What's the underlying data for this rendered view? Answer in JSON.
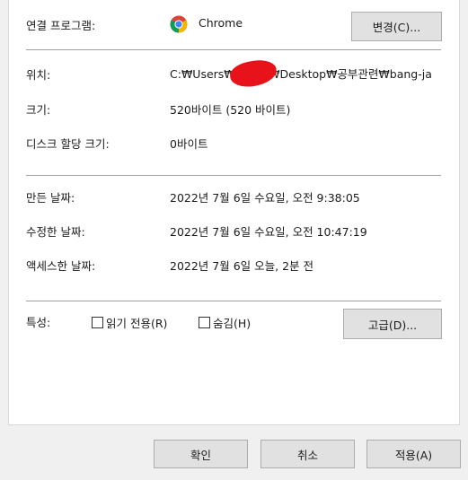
{
  "opens_with": {
    "label": "연결 프로그램:",
    "app_name": "Chrome",
    "icon": "chrome-icon",
    "change_button": "변경(C)..."
  },
  "location": {
    "label": "위치:",
    "value": "C:₩Users₩　　　₩Desktop₩공부관련₩bang-ja"
  },
  "size": {
    "label": "크기:",
    "value": "520바이트 (520 바이트)"
  },
  "size_on_disk": {
    "label": "디스크 할당 크기:",
    "value": "0바이트"
  },
  "created": {
    "label": "만든 날짜:",
    "value": "2022년 7월 6일 수요일, 오전 9:38:05"
  },
  "modified": {
    "label": "수정한 날짜:",
    "value": "2022년 7월 6일 수요일, 오전 10:47:19"
  },
  "accessed": {
    "label": "액세스한 날짜:",
    "value": "2022년 7월 6일 오늘, 2분 전"
  },
  "attributes": {
    "label": "특성:",
    "readonly_label": "읽기 전용(R)",
    "hidden_label": "숨김(H)",
    "advanced_button": "고급(D)..."
  },
  "footer": {
    "ok": "확인",
    "cancel": "취소",
    "apply": "적용(A)"
  },
  "colors": {
    "redaction": "#e8121b",
    "button_bg": "#e1e1e1",
    "separator": "#a0a0a0"
  }
}
